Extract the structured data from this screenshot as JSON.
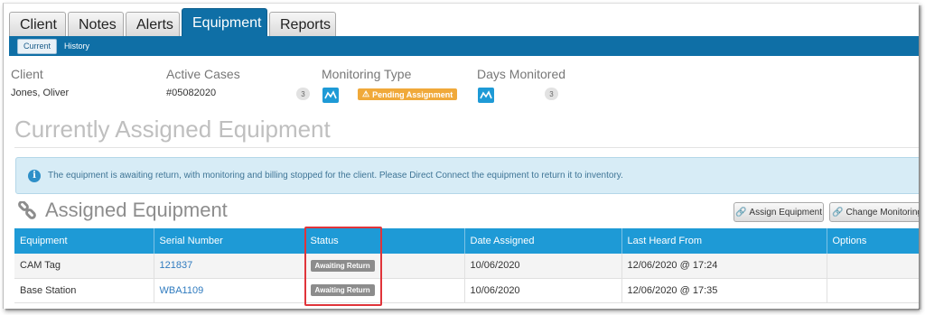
{
  "tabs": [
    "Client",
    "Notes",
    "Alerts",
    "Equipment",
    "Reports"
  ],
  "active_tab": "Equipment",
  "subtabs": [
    "Current",
    "History"
  ],
  "info": {
    "client_label": "Client",
    "client_value": "Jones, Oliver",
    "cases_label": "Active Cases",
    "cases_value": "#05082020",
    "cases_count": "3",
    "monitoring_label": "Monitoring Type",
    "pending_label": "Pending Assignment",
    "days_label": "Days Monitored",
    "days_count": "3"
  },
  "page_title": "Currently Assigned Equipment",
  "alert_text": "The equipment is awaiting return, with monitoring and billing stopped for the client. Please Direct Connect the equipment to return it to inventory.",
  "section_title": "Assigned Equipment",
  "buttons": {
    "assign": "Assign Equipment",
    "change": "Change Monitoring"
  },
  "table": {
    "headers": [
      "Equipment",
      "Serial Number",
      "Status",
      "Date Assigned",
      "Last Heard From",
      "Options"
    ],
    "rows": [
      {
        "equipment": "CAM Tag",
        "serial": "121837",
        "status": "Awaiting Return",
        "date_assigned": "10/06/2020",
        "last_heard": "12/06/2020 @ 17:24"
      },
      {
        "equipment": "Base Station",
        "serial": "WBA1109",
        "status": "Awaiting Return",
        "date_assigned": "10/06/2020",
        "last_heard": "12/06/2020 @ 17:35"
      }
    ]
  },
  "colors": {
    "primary_blue": "#0f6fa6",
    "table_header_blue": "#1e9ad6",
    "pending_orange": "#f0a93a",
    "highlight_red": "#e0343a"
  }
}
